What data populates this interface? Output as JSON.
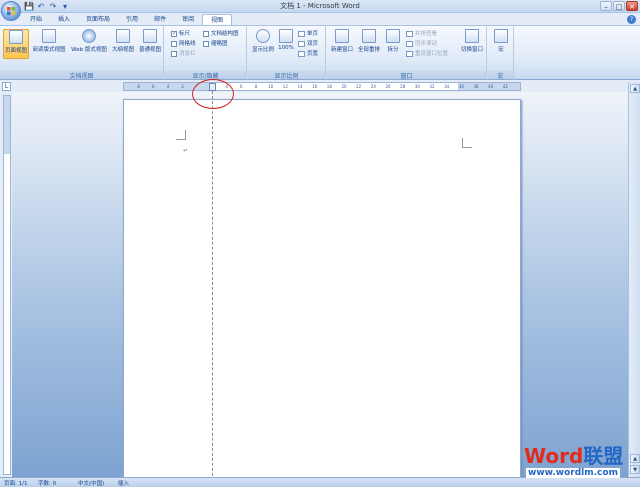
{
  "window": {
    "title": "文档 1 - Microsoft Word",
    "min": "–",
    "max": "□",
    "close": "✕"
  },
  "qat": {
    "save": "💾",
    "undo": "↶",
    "redo": "↷",
    "more": "▾"
  },
  "tabs": [
    "开始",
    "插入",
    "页面布局",
    "引用",
    "邮件",
    "审阅",
    "视图"
  ],
  "active_tab": "视图",
  "help": "?",
  "ribbon": {
    "doc_views": {
      "label": "文档视图",
      "buttons": [
        "页面视图",
        "阅读版式视图",
        "Web 版式视图",
        "大纲视图",
        "普通视图"
      ]
    },
    "show_hide": {
      "label": "显示/隐藏",
      "checks": [
        {
          "text": "标尺",
          "checked": true,
          "enabled": true
        },
        {
          "text": "网格线",
          "checked": false,
          "enabled": true
        },
        {
          "text": "消息栏",
          "checked": false,
          "enabled": false
        },
        {
          "text": "文档结构图",
          "checked": false,
          "enabled": true
        },
        {
          "text": "缩略图",
          "checked": false,
          "enabled": true
        }
      ],
      "check_mark": "✓"
    },
    "zoom": {
      "label": "显示比例",
      "zoom_btn": "显示比例",
      "hundred": "100%",
      "one_page": "单页",
      "two_pages": "双页",
      "page_width": "页宽"
    },
    "window": {
      "label": "窗口",
      "new_window": "新建窗口",
      "arrange_all": "全部重排",
      "split": "拆分",
      "side_by_side": "并排查看",
      "sync_scroll": "同步滚动",
      "reset_pos": "重设窗口位置",
      "switch": "切换窗口"
    },
    "macro": {
      "label": "宏",
      "button": "宏"
    }
  },
  "ruler": {
    "corner": "L",
    "ticks": [
      "8",
      "6",
      "4",
      "2",
      "",
      "2",
      "4",
      "6",
      "8",
      "10",
      "12",
      "14",
      "16",
      "18",
      "20",
      "22",
      "24",
      "26",
      "28",
      "30",
      "32",
      "34",
      "36",
      "38",
      "40",
      "42"
    ]
  },
  "document": {
    "para_mark": "↵"
  },
  "status": {
    "page": "页面: 1/1",
    "words": "字数: 0",
    "lang": "中文(中国)",
    "insert": "插入"
  },
  "watermark": {
    "word": "Word",
    "lm": "联盟",
    "url": "www.wordlm.com"
  },
  "colors": {
    "ribbon_accent": "#15428b",
    "active_button": "#ffc54f",
    "annotation": "#d32020"
  }
}
